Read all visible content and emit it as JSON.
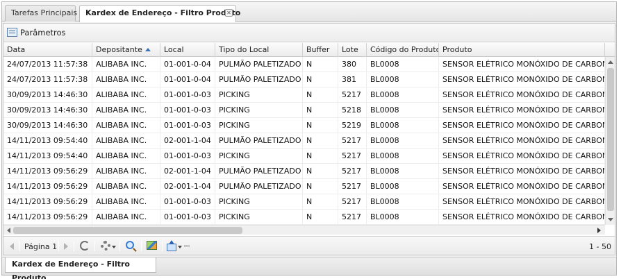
{
  "tabs": [
    {
      "label": "Tarefas Principais",
      "active": false
    },
    {
      "label": "Kardex de Endereço - Filtro Produto",
      "active": true
    }
  ],
  "parameters_label": "Parâmetros",
  "columns": [
    "Data",
    "Depositante",
    "Local",
    "Tipo do Local",
    "Buffer",
    "Lote",
    "Código do Produto",
    "Produto"
  ],
  "sorted_column": "Depositante",
  "sort_direction": "ascending",
  "rows": [
    [
      "24/07/2013 11:57:38",
      "ALIBABA INC.",
      "01-001-0-04",
      "PULMÃO PALETIZADO",
      "N",
      "380",
      "BL0008",
      "SENSOR ELÉTRICO MONÓXIDO DE CARBONO"
    ],
    [
      "24/07/2013 11:57:38",
      "ALIBABA INC.",
      "01-001-0-04",
      "PULMÃO PALETIZADO",
      "N",
      "381",
      "BL0008",
      "SENSOR ELÉTRICO MONÓXIDO DE CARBONO"
    ],
    [
      "30/09/2013 14:46:30",
      "ALIBABA INC.",
      "01-001-0-03",
      "PICKING",
      "N",
      "5217",
      "BL0008",
      "SENSOR ELÉTRICO MONÓXIDO DE CARBONO"
    ],
    [
      "30/09/2013 14:46:30",
      "ALIBABA INC.",
      "01-001-0-03",
      "PICKING",
      "N",
      "5218",
      "BL0008",
      "SENSOR ELÉTRICO MONÓXIDO DE CARBONO"
    ],
    [
      "30/09/2013 14:46:30",
      "ALIBABA INC.",
      "01-001-0-03",
      "PICKING",
      "N",
      "5219",
      "BL0008",
      "SENSOR ELÉTRICO MONÓXIDO DE CARBONO"
    ],
    [
      "14/11/2013 09:54:40",
      "ALIBABA INC.",
      "02-001-1-04",
      "PULMÃO PALETIZADO",
      "N",
      "5217",
      "BL0008",
      "SENSOR ELÉTRICO MONÓXIDO DE CARBONO"
    ],
    [
      "14/11/2013 09:54:40",
      "ALIBABA INC.",
      "01-001-0-03",
      "PICKING",
      "N",
      "5217",
      "BL0008",
      "SENSOR ELÉTRICO MONÓXIDO DE CARBONO"
    ],
    [
      "14/11/2013 09:56:29",
      "ALIBABA INC.",
      "02-001-1-04",
      "PULMÃO PALETIZADO",
      "N",
      "5217",
      "BL0008",
      "SENSOR ELÉTRICO MONÓXIDO DE CARBONO"
    ],
    [
      "14/11/2013 09:56:29",
      "ALIBABA INC.",
      "02-001-1-04",
      "PULMÃO PALETIZADO",
      "N",
      "5217",
      "BL0008",
      "SENSOR ELÉTRICO MONÓXIDO DE CARBONO"
    ],
    [
      "14/11/2013 09:56:29",
      "ALIBABA INC.",
      "01-001-0-03",
      "PICKING",
      "N",
      "5217",
      "BL0008",
      "SENSOR ELÉTRICO MONÓXIDO DE CARBONO"
    ],
    [
      "14/11/2013 09:56:29",
      "ALIBABA INC.",
      "01-001-0-03",
      "PICKING",
      "N",
      "5217",
      "BL0008",
      "SENSOR ELÉTRICO MONÓXIDO DE CARBONO"
    ]
  ],
  "paging": {
    "page_label": "Página 1",
    "range_label": "1 - 50"
  },
  "toolbar_icons": [
    "first-page-icon",
    "page-next-icon",
    "refresh-icon",
    "settings-icon",
    "search-icon",
    "chart-icon",
    "export-icon"
  ],
  "taskbar": {
    "active_window": "Kardex de Endereço - Filtro Produto"
  },
  "colors": {
    "sort_arrow": "#3b6fb6",
    "border": "#b8b8b8",
    "header_bg": "#ececec"
  }
}
